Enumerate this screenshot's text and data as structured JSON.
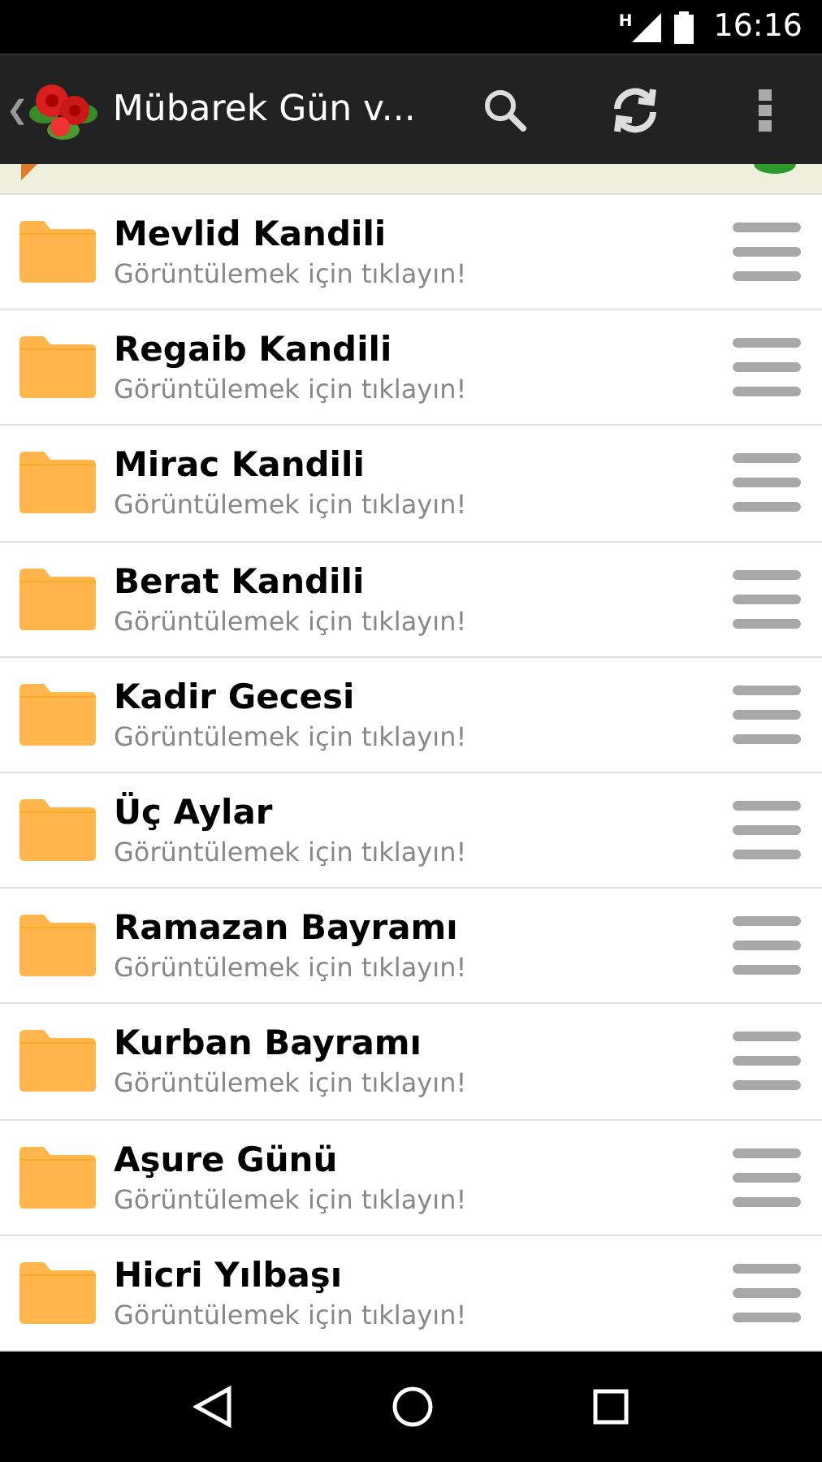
{
  "status_bar": {
    "network": "H",
    "time": "16:16"
  },
  "action_bar": {
    "back": "❮",
    "title": "Mübarek Gün v..."
  },
  "items": [
    {
      "title": "Mevlid Kandili",
      "subtitle": "Görüntülemek için tıklayın!"
    },
    {
      "title": "Regaib Kandili",
      "subtitle": "Görüntülemek için tıklayın!"
    },
    {
      "title": "Mirac Kandili",
      "subtitle": "Görüntülemek için tıklayın!"
    },
    {
      "title": "Berat Kandili",
      "subtitle": "Görüntülemek için tıklayın!"
    },
    {
      "title": "Kadir Gecesi",
      "subtitle": "Görüntülemek için tıklayın!"
    },
    {
      "title": "Üç Aylar",
      "subtitle": "Görüntülemek için tıklayın!"
    },
    {
      "title": "Ramazan Bayramı",
      "subtitle": "Görüntülemek için tıklayın!"
    },
    {
      "title": "Kurban Bayramı",
      "subtitle": "Görüntülemek için tıklayın!"
    },
    {
      "title": "Aşure Günü",
      "subtitle": "Görüntülemek için tıklayın!"
    },
    {
      "title": "Hicri Yılbaşı",
      "subtitle": "Görüntülemek için tıklayın!"
    }
  ]
}
